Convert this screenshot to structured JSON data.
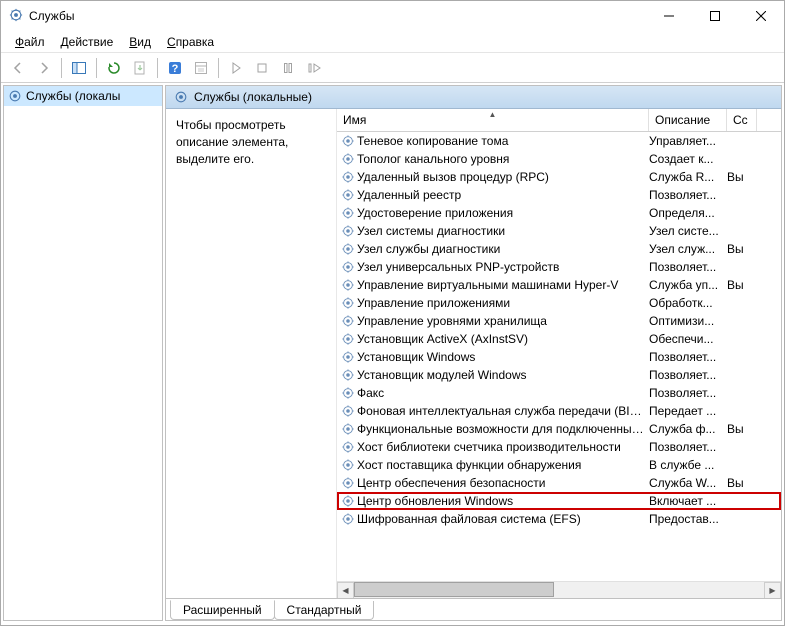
{
  "window": {
    "title": "Службы"
  },
  "menubar": [
    "Файл",
    "Действие",
    "Вид",
    "Справка"
  ],
  "nav": {
    "root": "Службы (локалы"
  },
  "detail_header": "Службы (локальные)",
  "description_hint": "Чтобы просмотреть описание элемента, выделите его.",
  "columns": {
    "name": "Имя",
    "desc": "Описание",
    "status": "Сс"
  },
  "tabs": {
    "extended": "Расширенный",
    "standard": "Стандартный"
  },
  "highlight_index": 20,
  "services": [
    {
      "name": "Теневое копирование тома",
      "desc": "Управляет...",
      "status": ""
    },
    {
      "name": "Тополог канального уровня",
      "desc": "Создает к...",
      "status": ""
    },
    {
      "name": "Удаленный вызов процедур (RPC)",
      "desc": "Служба R...",
      "status": "Вы"
    },
    {
      "name": "Удаленный реестр",
      "desc": "Позволяет...",
      "status": ""
    },
    {
      "name": "Удостоверение приложения",
      "desc": "Определя...",
      "status": ""
    },
    {
      "name": "Узел системы диагностики",
      "desc": "Узел систе...",
      "status": ""
    },
    {
      "name": "Узел службы диагностики",
      "desc": "Узел служ...",
      "status": "Вы"
    },
    {
      "name": "Узел универсальных PNP-устройств",
      "desc": "Позволяет...",
      "status": ""
    },
    {
      "name": "Управление виртуальными машинами Hyper-V",
      "desc": "Служба уп...",
      "status": "Вы"
    },
    {
      "name": "Управление приложениями",
      "desc": "Обработк...",
      "status": ""
    },
    {
      "name": "Управление уровнями хранилища",
      "desc": "Оптимизи...",
      "status": ""
    },
    {
      "name": "Установщик ActiveX (AxInstSV)",
      "desc": "Обеспечи...",
      "status": ""
    },
    {
      "name": "Установщик Windows",
      "desc": "Позволяет...",
      "status": ""
    },
    {
      "name": "Установщик модулей Windows",
      "desc": "Позволяет...",
      "status": ""
    },
    {
      "name": "Факс",
      "desc": "Позволяет...",
      "status": ""
    },
    {
      "name": "Фоновая интеллектуальная служба передачи (BITS)",
      "desc": "Передает ...",
      "status": ""
    },
    {
      "name": "Функциональные возможности для подключенных ...",
      "desc": "Служба ф...",
      "status": "Вы"
    },
    {
      "name": "Хост библиотеки счетчика производительности",
      "desc": "Позволяет...",
      "status": ""
    },
    {
      "name": "Хост поставщика функции обнаружения",
      "desc": "В службе ...",
      "status": ""
    },
    {
      "name": "Центр обеспечения безопасности",
      "desc": "Служба W...",
      "status": "Вы"
    },
    {
      "name": "Центр обновления Windows",
      "desc": "Включает ...",
      "status": ""
    },
    {
      "name": "Шифрованная файловая система (EFS)",
      "desc": "Предостав...",
      "status": ""
    }
  ]
}
